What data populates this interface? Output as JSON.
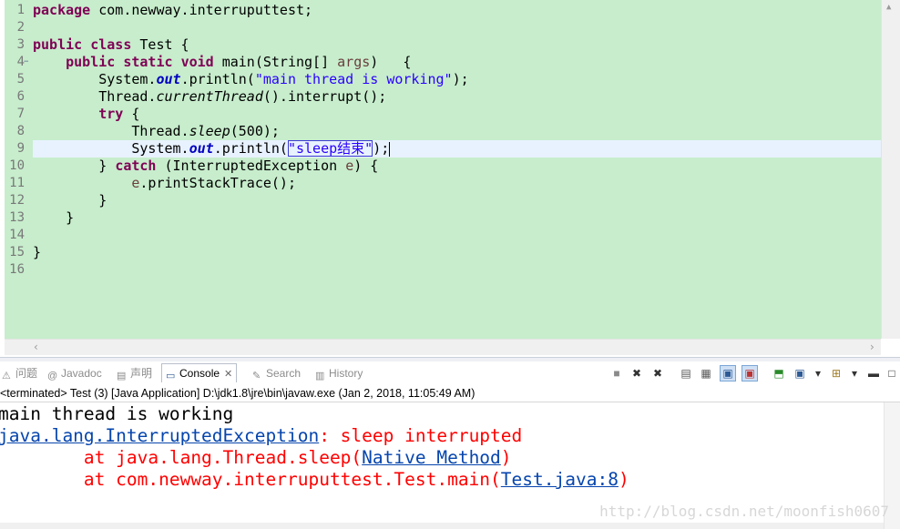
{
  "editor": {
    "lines": [
      {
        "n": "1",
        "tokens": [
          {
            "t": "package",
            "c": "kw"
          },
          {
            "t": " com.newway.interruputtest;"
          }
        ]
      },
      {
        "n": "2",
        "tokens": []
      },
      {
        "n": "3",
        "tokens": [
          {
            "t": "public",
            "c": "kw"
          },
          {
            "t": " "
          },
          {
            "t": "class",
            "c": "kw"
          },
          {
            "t": " Test {"
          }
        ]
      },
      {
        "n": "4",
        "fold": "−",
        "tokens": [
          {
            "t": "    "
          },
          {
            "t": "public",
            "c": "kw"
          },
          {
            "t": " "
          },
          {
            "t": "static",
            "c": "kw"
          },
          {
            "t": " "
          },
          {
            "t": "void",
            "c": "kw"
          },
          {
            "t": " main(String[] "
          },
          {
            "t": "args",
            "c": "param"
          },
          {
            "t": ")   {"
          }
        ]
      },
      {
        "n": "5",
        "tokens": [
          {
            "t": "        System."
          },
          {
            "t": "out",
            "c": "fld"
          },
          {
            "t": ".println("
          },
          {
            "t": "\"main thread is working\"",
            "c": "str"
          },
          {
            "t": ");"
          }
        ]
      },
      {
        "n": "6",
        "tokens": [
          {
            "t": "        Thread."
          },
          {
            "t": "currentThread",
            "c": "ital"
          },
          {
            "t": "().interrupt();"
          }
        ]
      },
      {
        "n": "7",
        "tokens": [
          {
            "t": "        "
          },
          {
            "t": "try",
            "c": "kw"
          },
          {
            "t": " {"
          }
        ]
      },
      {
        "n": "8",
        "tokens": [
          {
            "t": "            Thread."
          },
          {
            "t": "sleep",
            "c": "ital"
          },
          {
            "t": "(500);"
          }
        ]
      },
      {
        "n": "9",
        "current": true,
        "tokens": [
          {
            "t": "            System."
          },
          {
            "t": "out",
            "c": "fld"
          },
          {
            "t": ".println("
          },
          {
            "t": "\"sleep结束\"",
            "c": "str boxed"
          },
          {
            "t": ");"
          },
          {
            "t": "",
            "c": "caret"
          }
        ]
      },
      {
        "n": "10",
        "tokens": [
          {
            "t": "        } "
          },
          {
            "t": "catch",
            "c": "kw"
          },
          {
            "t": " (InterruptedException "
          },
          {
            "t": "e",
            "c": "param"
          },
          {
            "t": ") {"
          }
        ]
      },
      {
        "n": "11",
        "tokens": [
          {
            "t": "            "
          },
          {
            "t": "e",
            "c": "param"
          },
          {
            "t": ".printStackTrace();"
          }
        ]
      },
      {
        "n": "12",
        "tokens": [
          {
            "t": "        }"
          }
        ]
      },
      {
        "n": "13",
        "tokens": [
          {
            "t": "    }"
          }
        ]
      },
      {
        "n": "14",
        "tokens": []
      },
      {
        "n": "15",
        "tokens": [
          {
            "t": "}"
          }
        ]
      },
      {
        "n": "16",
        "tokens": []
      }
    ]
  },
  "tabs": [
    {
      "label": "问题",
      "icon": "problems-icon"
    },
    {
      "label": "Javadoc",
      "icon": "javadoc-icon"
    },
    {
      "label": "声明",
      "icon": "declaration-icon"
    },
    {
      "label": "Console",
      "icon": "console-icon",
      "active": true,
      "close": "✕"
    },
    {
      "label": "Search",
      "icon": "search-icon"
    },
    {
      "label": "History",
      "icon": "history-icon"
    }
  ],
  "console": {
    "status": "<terminated> Test (3) [Java Application] D:\\jdk1.8\\jre\\bin\\javaw.exe (Jan 2, 2018, 11:05:49 AM)",
    "output": [
      {
        "parts": [
          {
            "t": "main thread is working",
            "c": "out-black"
          }
        ]
      },
      {
        "parts": [
          {
            "t": "java.lang.InterruptedException",
            "c": "link"
          },
          {
            "t": ": sleep interrupted",
            "c": "out-red"
          }
        ]
      },
      {
        "parts": [
          {
            "t": "\tat java.lang.Thread.sleep(",
            "c": "out-red"
          },
          {
            "t": "Native Method",
            "c": "link"
          },
          {
            "t": ")",
            "c": "out-red"
          }
        ]
      },
      {
        "parts": [
          {
            "t": "\tat com.newway.interruputtest.Test.main(",
            "c": "out-red"
          },
          {
            "t": "Test.java:8",
            "c": "link"
          },
          {
            "t": ")",
            "c": "out-red"
          }
        ]
      }
    ],
    "watermark": "http://blog.csdn.net/moonfish0607"
  },
  "toolbar": [
    {
      "name": "terminate-button",
      "glyph": "■"
    },
    {
      "name": "remove-launch-button",
      "glyph": "✖"
    },
    {
      "name": "remove-all-terminated-button",
      "glyph": "✖"
    },
    {
      "name": "scroll-lock-button",
      "glyph": "▤"
    },
    {
      "name": "word-wrap-button",
      "glyph": "▦"
    },
    {
      "name": "show-on-stdout-button",
      "glyph": "▣",
      "pressed": true
    },
    {
      "name": "show-on-stderr-button",
      "glyph": "▣",
      "pressed": true
    },
    {
      "name": "pin-console-button",
      "glyph": "⬒"
    },
    {
      "name": "display-console-button",
      "glyph": "▣"
    },
    {
      "name": "display-console-dropdown",
      "glyph": "▾"
    },
    {
      "name": "open-console-button",
      "glyph": "⊞"
    },
    {
      "name": "open-console-dropdown",
      "glyph": "▾"
    },
    {
      "name": "minimize-button",
      "glyph": "▬"
    },
    {
      "name": "maximize-button",
      "glyph": "□"
    }
  ],
  "colors": {
    "editor_background": "#c7edcc",
    "keyword": "#7f0055",
    "string": "#2a00ff",
    "static_field": "#0000c0",
    "error_text": "#ff0000",
    "link": "#0645ad"
  }
}
